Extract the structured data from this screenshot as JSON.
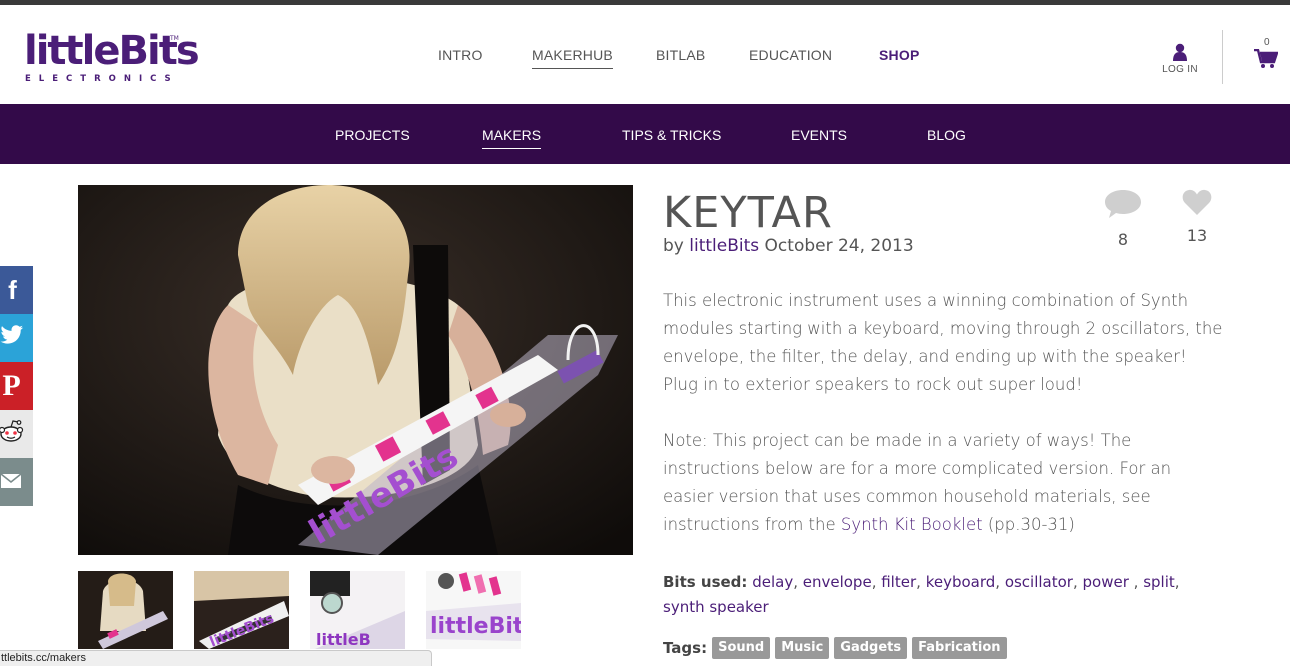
{
  "brand": {
    "name": "littleBits",
    "tagline": "ELECTRONICS",
    "tm": "TM"
  },
  "main_nav": [
    {
      "label": "INTRO"
    },
    {
      "label": "MAKERHUB"
    },
    {
      "label": "BITLAB"
    },
    {
      "label": "EDUCATION"
    },
    {
      "label": "SHOP"
    }
  ],
  "account": {
    "login_label": "LOG IN",
    "cart_count": "0"
  },
  "sub_nav": [
    {
      "label": "PROJECTS"
    },
    {
      "label": "MAKERS"
    },
    {
      "label": "TIPS & TRICKS"
    },
    {
      "label": "EVENTS"
    },
    {
      "label": "BLOG"
    }
  ],
  "social": {
    "facebook": "f",
    "twitter": "twitter-icon",
    "pinterest": "P",
    "reddit": "reddit-icon",
    "email": "email-icon"
  },
  "project": {
    "title": "KEYTAR",
    "by": "by",
    "author": "littleBits",
    "date": "October 24, 2013",
    "comments": "8",
    "likes": "13",
    "description": "This electronic instrument uses a winning combination of Synth modules starting with a keyboard, moving through 2 oscillators, the envelope, the filter, the delay, and ending up with the speaker! Plug in to exterior speakers to rock out super loud!",
    "note_before": "Note: This project can be made in a variety of ways! The instructions below are for a more complicated version. For an easier version that uses common household materials, see instructions from the",
    "note_link": "Synth Kit Booklet",
    "note_after": "(pp.30-31)",
    "bits_label": "Bits used:",
    "bits": [
      "delay",
      "envelope",
      "filter",
      "keyboard",
      "oscillator",
      "power",
      "split",
      "synth speaker"
    ],
    "tags_label": "Tags:",
    "tags": [
      "Sound",
      "Music",
      "Gadgets",
      "Fabrication"
    ]
  },
  "statusbar": {
    "url": "ttlebits.cc/makers"
  }
}
